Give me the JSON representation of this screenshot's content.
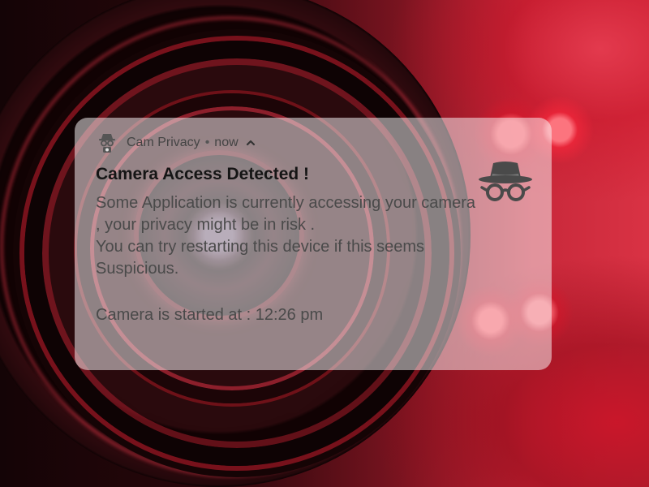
{
  "notification": {
    "app_name": "Cam Privacy",
    "separator": "•",
    "time": "now",
    "title": "Camera Access Detected !",
    "body_lines": [
      "Some Application is currently accessing your camera , your privacy might be in risk .",
      "You can try restarting this device if this seems Suspicious."
    ],
    "started_text": "Camera is started at : 12:26 pm",
    "icons": {
      "app": "camera-spy-icon",
      "expand": "chevron-up-icon",
      "large": "incognito-spy-icon"
    }
  },
  "colors": {
    "background_accent": "#c8283a",
    "card_background": "rgba(250,246,247,0.52)",
    "title_text": "#151515",
    "body_text": "#4a4a4a"
  }
}
